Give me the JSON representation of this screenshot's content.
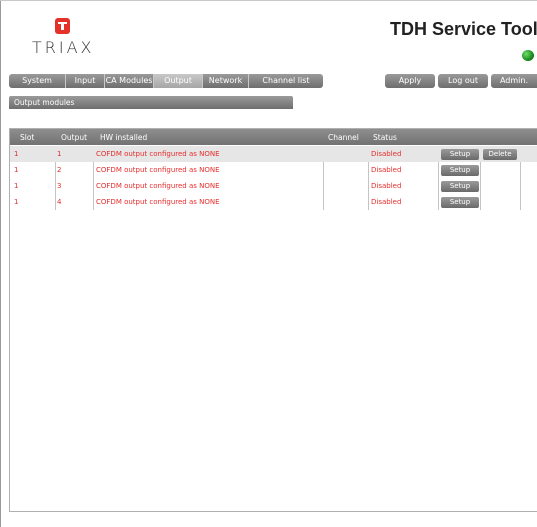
{
  "brand": {
    "logo_text": "TRIAX"
  },
  "app": {
    "title": "TDH Service Tool",
    "status_led": "#2aa52a"
  },
  "nav": {
    "tabs": [
      {
        "label": "System"
      },
      {
        "label": "Input"
      },
      {
        "label": "CA Modules"
      },
      {
        "label": "Output",
        "active": true
      },
      {
        "label": "Network"
      },
      {
        "label": "Channel list"
      }
    ]
  },
  "toolbar": {
    "apply_label": "Apply",
    "logout_label": "Log out",
    "admin_label": "Admin."
  },
  "section": {
    "title": "Output modules"
  },
  "table": {
    "headers": {
      "slot": "Slot",
      "output": "Output",
      "hw": "HW installed",
      "channel": "Channel",
      "status": "Status"
    },
    "rows": [
      {
        "slot": "1",
        "output": "1",
        "hw": "COFDM output configured as NONE",
        "channel": "",
        "status": "Disabled",
        "setup": "Setup",
        "delete": "Delete"
      },
      {
        "slot": "1",
        "output": "2",
        "hw": "COFDM output configured as NONE",
        "channel": "",
        "status": "Disabled",
        "setup": "Setup"
      },
      {
        "slot": "1",
        "output": "3",
        "hw": "COFDM output configured as NONE",
        "channel": "",
        "status": "Disabled",
        "setup": "Setup"
      },
      {
        "slot": "1",
        "output": "4",
        "hw": "COFDM output configured as NONE",
        "channel": "",
        "status": "Disabled",
        "setup": "Setup"
      }
    ]
  },
  "colors": {
    "row_text": "#e52d2d",
    "logo_red": "#e4322b"
  }
}
